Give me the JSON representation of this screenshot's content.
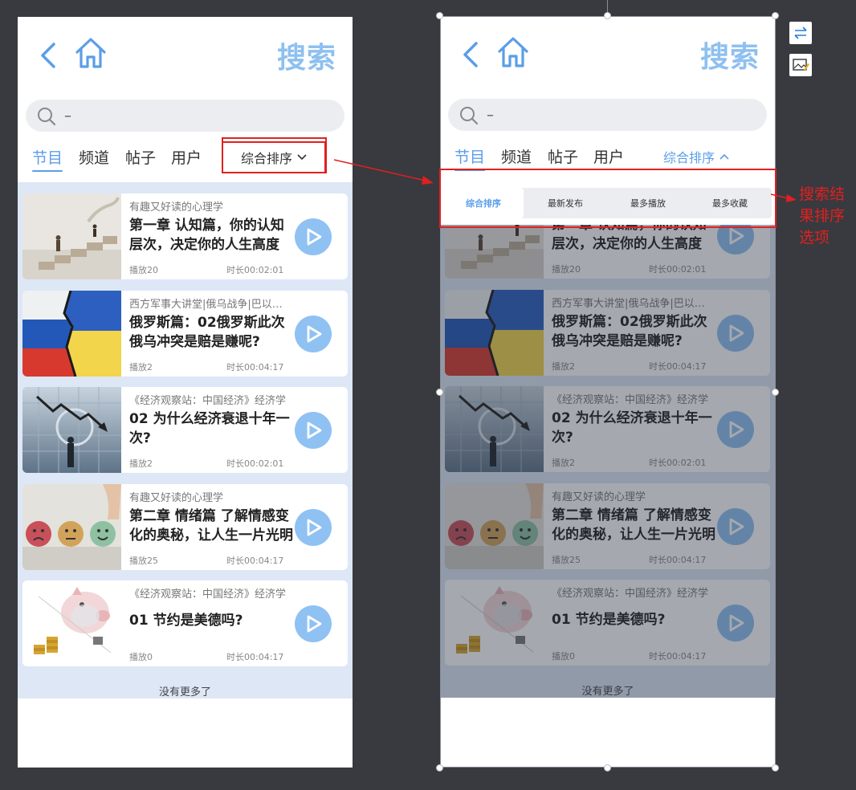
{
  "header": {
    "title": "搜索"
  },
  "search": {
    "value": "–"
  },
  "tabs": [
    {
      "label": "节目"
    },
    {
      "label": "频道"
    },
    {
      "label": "帖子"
    },
    {
      "label": "用户"
    }
  ],
  "sort": {
    "current": "综合排序"
  },
  "sort_options": [
    {
      "label": "综合排序"
    },
    {
      "label": "最新发布"
    },
    {
      "label": "最多播放"
    },
    {
      "label": "最多收藏"
    }
  ],
  "results": [
    {
      "channel": "有趣又好读的心理学",
      "title": "第一章 认知篇，你的认知层次，决定你的人生高度",
      "plays": "播放20",
      "duration": "时长00:02:01",
      "thumb": "stairs"
    },
    {
      "channel": "西方军事大讲堂|俄乌战争|巴以冲突",
      "title": "俄罗斯篇：02俄罗斯此次俄乌冲突是赔是赚呢?",
      "plays": "播放2",
      "duration": "时长00:04:17",
      "thumb": "flags"
    },
    {
      "channel": "《经济观察站：中国经济》经济学",
      "title": "02 为什么经济衰退十年一次?",
      "plays": "播放2",
      "duration": "时长00:02:01",
      "thumb": "decline"
    },
    {
      "channel": "有趣又好读的心理学",
      "title": "第二章 情绪篇 了解情感变化的奥秘，让人生一片光明",
      "plays": "播放25",
      "duration": "时长00:04:17",
      "thumb": "emotions"
    },
    {
      "channel": "《经济观察站：中国经济》经济学",
      "title": "01 节约是美德吗?",
      "plays": "播放0",
      "duration": "时长00:04:17",
      "thumb": "piggy"
    }
  ],
  "footer": {
    "no_more": "没有更多了"
  },
  "annotation": {
    "text": "搜索结果排序选项"
  },
  "colors": {
    "accent": "#5b9ee8",
    "title": "#8ec0f0",
    "annotation": "#e02020",
    "list_bg": "#dde7f6"
  }
}
